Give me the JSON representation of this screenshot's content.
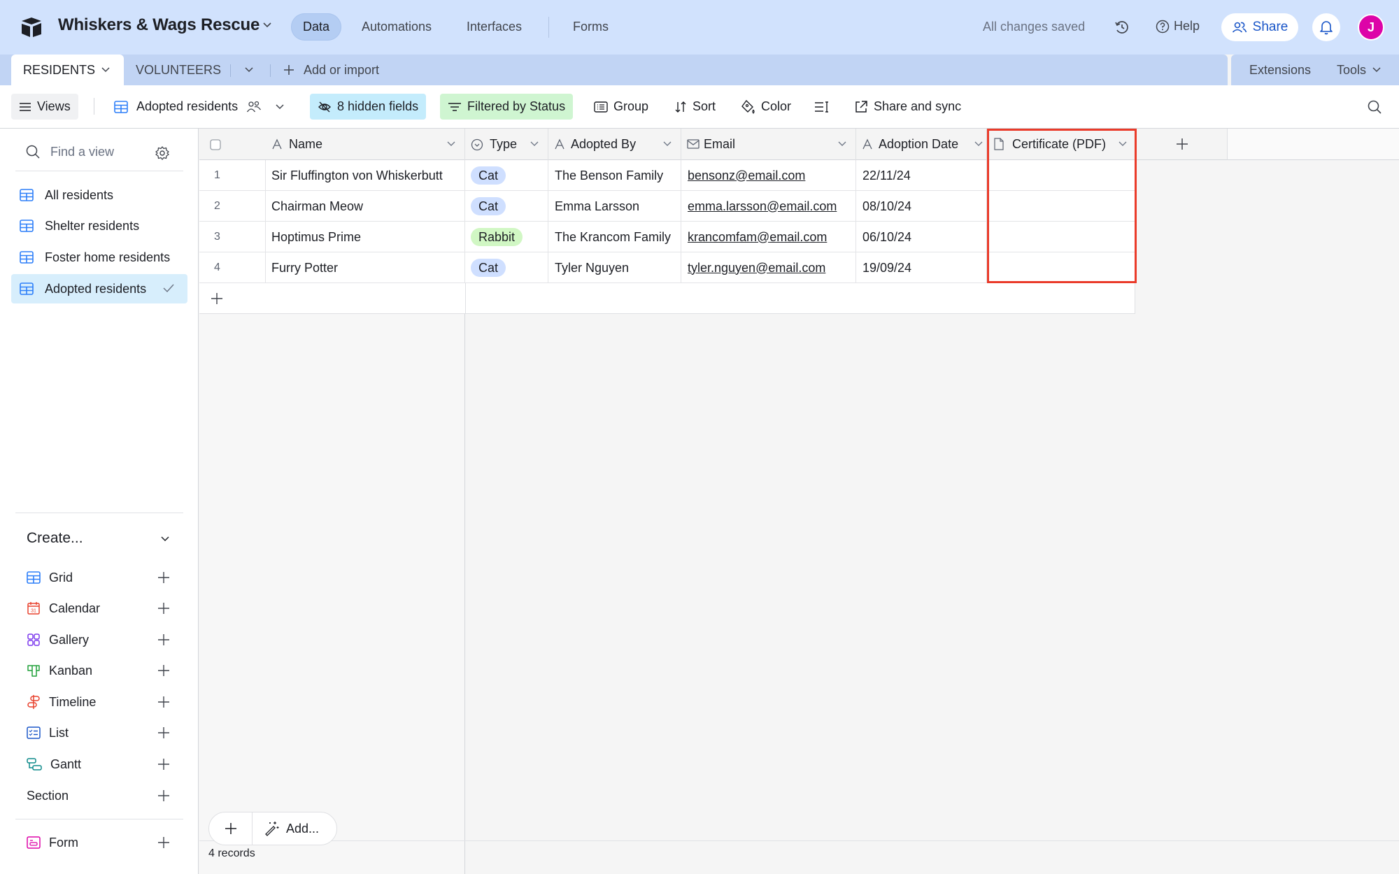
{
  "app": {
    "base_name": "Whiskers & Wags Rescue",
    "nav": [
      {
        "label": "Data",
        "active": true
      },
      {
        "label": "Automations",
        "active": false
      },
      {
        "label": "Interfaces",
        "active": false
      },
      {
        "label": "Forms",
        "active": false
      }
    ],
    "save_status": "All changes saved",
    "help_label": "Help",
    "share_label": "Share",
    "avatar_initial": "J",
    "avatar_color": "#dd04a8"
  },
  "tables": {
    "tabs": [
      {
        "label": "RESIDENTS",
        "active": true
      },
      {
        "label": "VOLUNTEERS",
        "active": false
      }
    ],
    "add_label": "Add or import",
    "extensions_label": "Extensions",
    "tools_label": "Tools"
  },
  "toolbar": {
    "views_label": "Views",
    "current_view": "Adopted residents",
    "hidden_fields": "8 hidden fields",
    "filter": "Filtered by Status",
    "group": "Group",
    "sort": "Sort",
    "color": "Color",
    "share_sync": "Share and sync"
  },
  "sidebar": {
    "find_placeholder": "Find a view",
    "views": [
      {
        "label": "All residents",
        "selected": false
      },
      {
        "label": "Shelter residents",
        "selected": false
      },
      {
        "label": "Foster home residents",
        "selected": false
      },
      {
        "label": "Adopted residents",
        "selected": true
      }
    ],
    "create_heading": "Create...",
    "create_items": [
      {
        "label": "Grid",
        "icon": "grid-icon",
        "color": "#2d7ff9"
      },
      {
        "label": "Calendar",
        "icon": "calendar-icon",
        "color": "#e8422e"
      },
      {
        "label": "Gallery",
        "icon": "gallery-icon",
        "color": "#7c39ed"
      },
      {
        "label": "Kanban",
        "icon": "kanban-icon",
        "color": "#20a13a"
      },
      {
        "label": "Timeline",
        "icon": "timeline-icon",
        "color": "#e8422e"
      },
      {
        "label": "List",
        "icon": "list-icon",
        "color": "#1a56c8"
      },
      {
        "label": "Gantt",
        "icon": "gantt-icon",
        "color": "#0d8a8a"
      },
      {
        "label": "Section",
        "icon": "",
        "color": ""
      },
      {
        "label": "Form",
        "icon": "form-icon",
        "color": "#dd04a8"
      }
    ]
  },
  "grid": {
    "columns": [
      {
        "label": "Name",
        "icon": "text-field-icon"
      },
      {
        "label": "Type",
        "icon": "single-select-icon"
      },
      {
        "label": "Adopted By",
        "icon": "text-field-icon"
      },
      {
        "label": "Email",
        "icon": "email-field-icon"
      },
      {
        "label": "Adoption Date",
        "icon": "text-field-icon"
      },
      {
        "label": "Certificate (PDF)",
        "icon": "attachment-field-icon"
      }
    ],
    "rows": [
      {
        "num": "1",
        "name": "Sir Fluffington von Whiskerbutt",
        "type": "Cat",
        "adopted_by": "The Benson Family",
        "email": "bensonz@email.com",
        "date": "22/11/24",
        "certificate": ""
      },
      {
        "num": "2",
        "name": "Chairman Meow",
        "type": "Cat",
        "adopted_by": "Emma Larsson",
        "email": "emma.larsson@email.com",
        "date": "08/10/24",
        "certificate": ""
      },
      {
        "num": "3",
        "name": "Hoptimus Prime",
        "type": "Rabbit",
        "adopted_by": "The Krancom Family",
        "email": "krancomfam@email.com",
        "date": "06/10/24",
        "certificate": ""
      },
      {
        "num": "4",
        "name": "Furry Potter",
        "type": "Cat",
        "adopted_by": "Tyler Nguyen",
        "email": "tyler.nguyen@email.com",
        "date": "19/09/24",
        "certificate": ""
      }
    ],
    "type_colors": {
      "Cat": "#cfdfff",
      "Rabbit": "#d1f7c4"
    },
    "highlight_color": "#ea3b2a",
    "highlighted_column": "Certificate (PDF)"
  },
  "footer": {
    "add_label": "Add...",
    "record_count": "4 records"
  }
}
